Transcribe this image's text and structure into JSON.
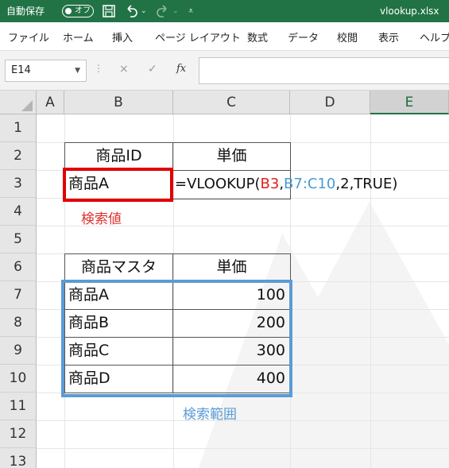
{
  "titlebar": {
    "autosave_label": "自動保存",
    "autosave_state": "オフ",
    "filename": "vlookup.xlsx",
    "color": "#217346"
  },
  "ribbon_tabs": [
    "ファイル",
    "ホーム",
    "挿入",
    "ページ レイアウト",
    "数式",
    "データ",
    "校閲",
    "表示",
    "ヘルプ"
  ],
  "formula_bar": {
    "name_box": "E14",
    "cancel_icon": "×",
    "enter_icon": "✓",
    "fx_label": "fx",
    "content": ""
  },
  "columns": [
    "A",
    "B",
    "C",
    "D",
    "E"
  ],
  "selected_column": "E",
  "rows": [
    "1",
    "2",
    "3",
    "4",
    "5",
    "6",
    "7",
    "8",
    "9",
    "10",
    "11",
    "12",
    "13"
  ],
  "cells": {
    "B2": "商品ID",
    "C2": "単価",
    "B3": "商品A",
    "C3": {
      "prefix": "=VLOOKUP(",
      "ref1": "B3",
      "sep1": ",",
      "ref2": "B7:C10",
      "suffix": ",2,TRUE)"
    },
    "B6": "商品マスタ",
    "C6": "単価",
    "master": [
      {
        "name": "商品A",
        "price": "100"
      },
      {
        "name": "商品B",
        "price": "200"
      },
      {
        "name": "商品C",
        "price": "300"
      },
      {
        "name": "商品D",
        "price": "400"
      }
    ]
  },
  "annotations": {
    "lookup_value": "検索値",
    "lookup_range": "検索範囲",
    "lookup_value_color": "#e00000",
    "lookup_range_color": "#5b9bd5"
  }
}
